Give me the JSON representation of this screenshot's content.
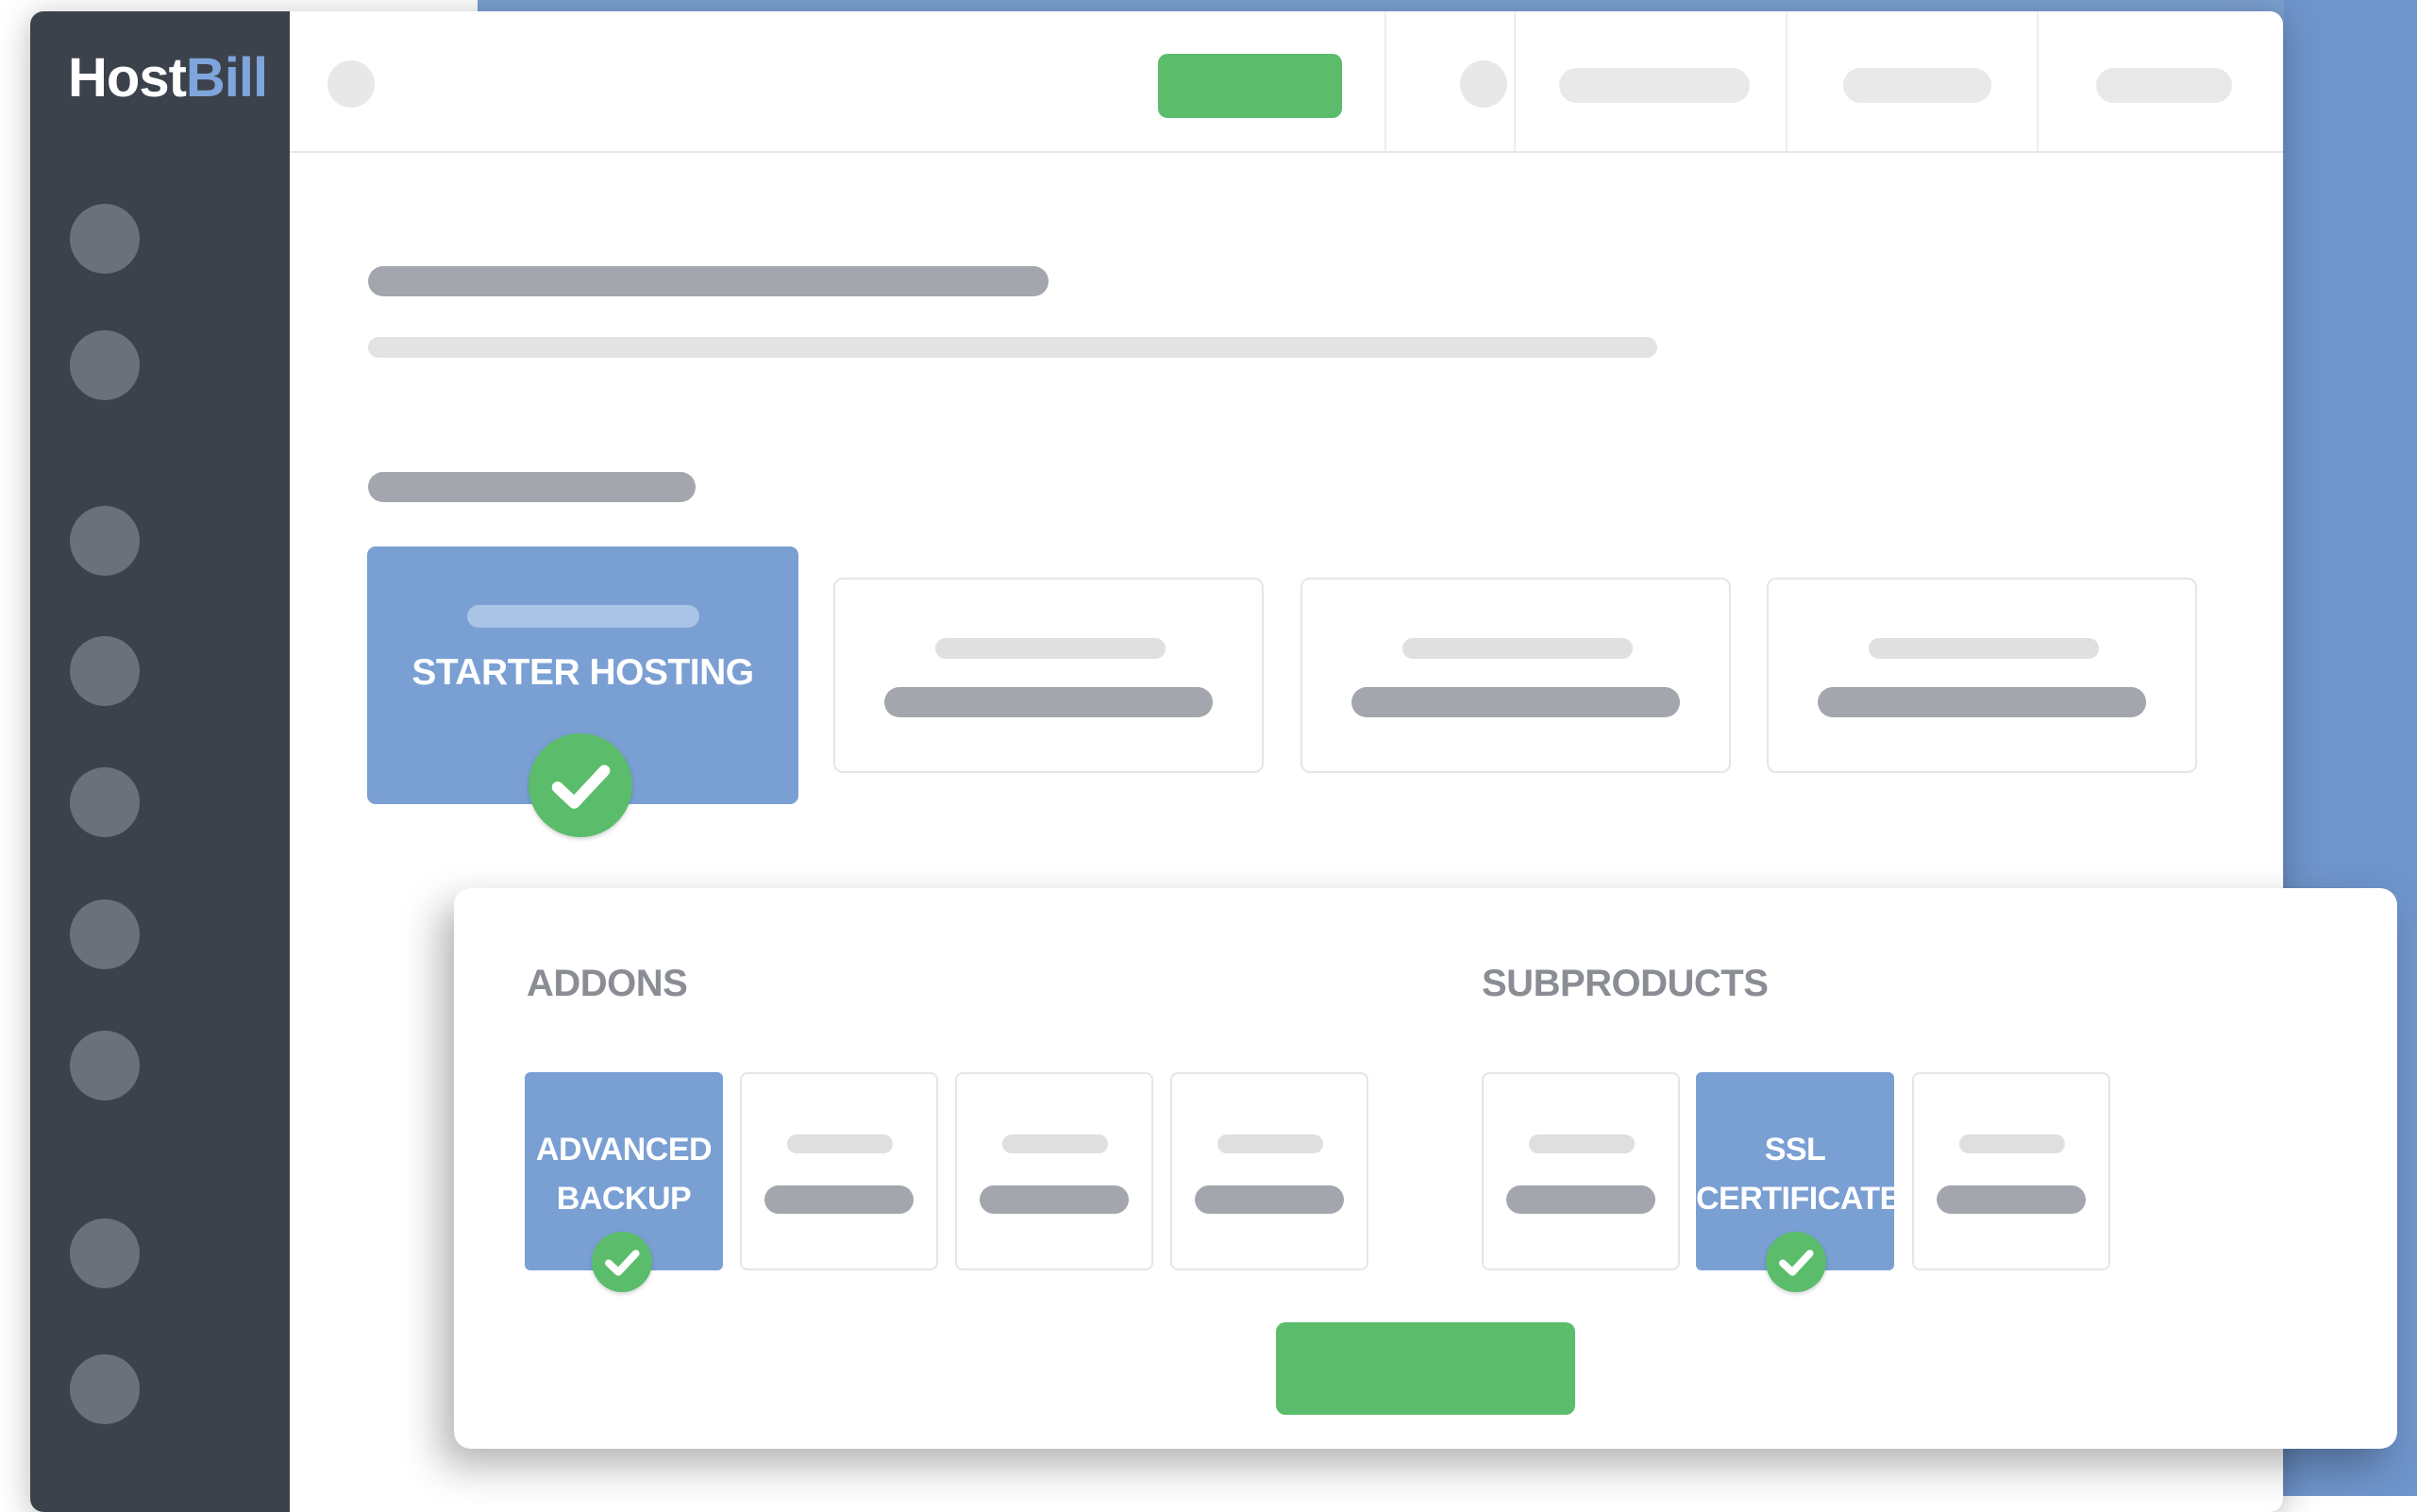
{
  "brand": {
    "host": "Host",
    "bill": "Bill"
  },
  "colors": {
    "background_blue": "#7b9fd0",
    "sidebar": "#3c424c",
    "selected_card": "#7a9fd3",
    "accent_green": "#5bbd6b",
    "placeholder_dark": "#a3a6ad",
    "placeholder_light": "#e3e3e3"
  },
  "plans": {
    "selected": {
      "title": "STARTER HOSTING",
      "icon": "check-icon"
    }
  },
  "options": {
    "addons": {
      "heading": "ADDONS",
      "selected": {
        "label_line1": "ADVANCED",
        "label_line2": "BACKUP",
        "icon": "check-icon"
      }
    },
    "subproducts": {
      "heading": "SUBPRODUCTS",
      "selected": {
        "label_line1": "SSL",
        "label_line2": "CERTIFICATE",
        "icon": "check-icon"
      }
    }
  }
}
